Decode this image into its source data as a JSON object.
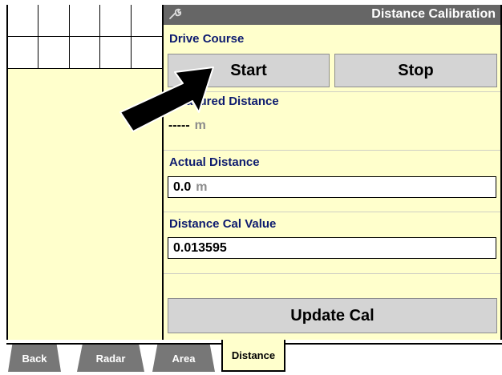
{
  "title": "Distance Calibration",
  "drive_course": {
    "label": "Drive Course",
    "start_label": "Start",
    "stop_label": "Stop"
  },
  "measured_distance": {
    "label": "Measured Distance",
    "value": "-----",
    "unit": "m"
  },
  "actual_distance": {
    "label": "Actual Distance",
    "value": "0.0",
    "unit": "m"
  },
  "distance_cal_value": {
    "label": "Distance Cal Value",
    "value": "0.013595"
  },
  "update_cal_label": "Update Cal",
  "tabs": [
    {
      "label": "Back",
      "active": false
    },
    {
      "label": "Radar",
      "active": false
    },
    {
      "label": "Area",
      "active": false
    },
    {
      "label": "Distance",
      "active": true
    }
  ],
  "icons": {
    "title": "wrench-icon",
    "overlay": "pointer-arrow-icon"
  },
  "colors": {
    "panel_background": "#ffffcc",
    "title_bar": "#666666",
    "label_text": "#0d1b6f",
    "button": "#d4d4d4",
    "tab_inactive": "#777777"
  }
}
